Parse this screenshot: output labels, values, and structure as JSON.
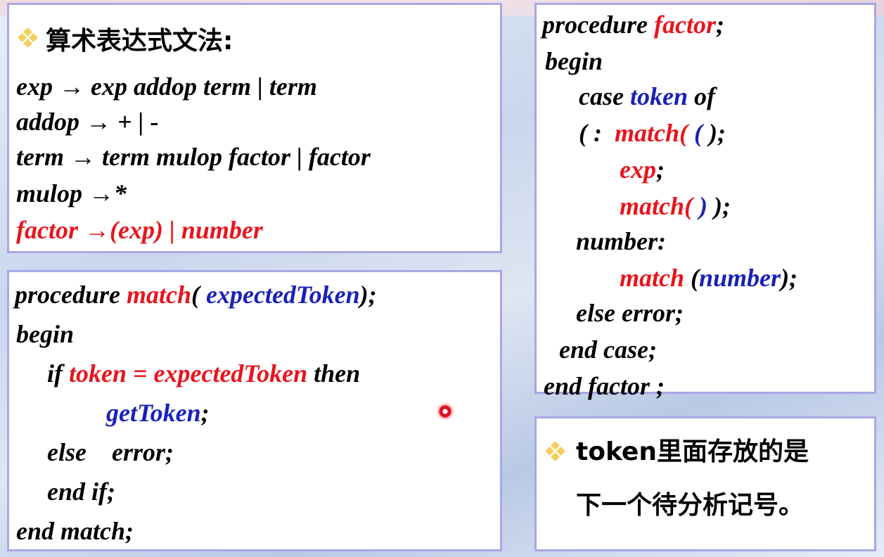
{
  "grammar": {
    "heading": "算术表达式文法:",
    "rule1": "exp → exp addop term | term",
    "rule2": "addop → + | -",
    "rule3": "term → term mulop factor | factor",
    "rule4": "mulop →*",
    "rule5": "factor →(exp) | number"
  },
  "match_proc": {
    "l1_kw": "procedure ",
    "l1_name": "match",
    "l1_open": "( ",
    "l1_param": "expectedToken",
    "l1_close": ");",
    "l2": "begin",
    "l3_kw": "if ",
    "l3_cond": "token = expectedToken",
    "l3_then": " then",
    "l4_call": "getToken",
    "l4_semi": ";",
    "l5": "else    error;",
    "l6": "end if;",
    "l7": "end match;"
  },
  "factor_proc": {
    "l1_kw": "procedure ",
    "l1_name": "factor",
    "l1_semi": ";",
    "l2": "begin",
    "l3_kw": "case ",
    "l3_token": "token",
    "l3_of": " of",
    "l4_label": "( :  ",
    "l4_match": "match",
    "l4_open": "( ",
    "l4_arg": "(",
    "l4_close": " );",
    "l5_exp": "exp",
    "l5_semi": ";",
    "l6_match": "match",
    "l6_open": "( ",
    "l6_arg": ")",
    "l6_close": " );",
    "l7": "number:",
    "l8_match": "match",
    "l8_open": " (",
    "l8_arg": "number",
    "l8_close": ");",
    "l9": "else error;",
    "l10": "end case;",
    "l11": "end factor ;"
  },
  "note": {
    "line1": "token里面存放的是",
    "line2": "下一个待分析记号。"
  }
}
